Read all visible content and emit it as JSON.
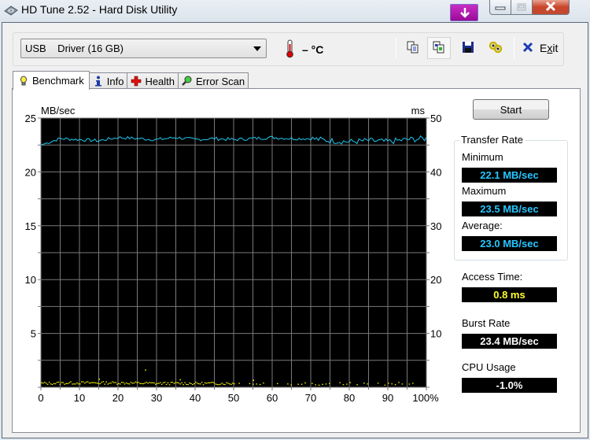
{
  "window": {
    "title": "HD Tune 2.52 - Hard Disk Utility",
    "icons": {
      "app": "hard-disk-icon",
      "download_badge": "download-arrow-icon",
      "minimize": "minimize-icon",
      "maximize": "maximize-icon",
      "close": "close-icon"
    }
  },
  "toolbar": {
    "drive_select": {
      "bus": "USB",
      "name": "Driver (16 GB)",
      "value": "USB    Driver (16 GB)"
    },
    "temperature": "– °C",
    "buttons": [
      {
        "name": "copy-text",
        "icon": "copy-text-icon"
      },
      {
        "name": "copy-screenshot",
        "icon": "copy-screenshot-icon",
        "active": true
      },
      {
        "name": "save",
        "icon": "floppy-disk-icon"
      },
      {
        "name": "options",
        "icon": "options-icon"
      }
    ],
    "exit_label": "Exit",
    "exit_mnemonic_prefix": "E",
    "exit_mnemonic_char": "x",
    "exit_mnemonic_suffix": "it"
  },
  "tabs": [
    {
      "label": "Benchmark",
      "icon": "lightbulb-icon",
      "active": true
    },
    {
      "label": "Info",
      "icon": "info-icon",
      "active": false
    },
    {
      "label": "Health",
      "icon": "health-cross-icon",
      "active": false
    },
    {
      "label": "Error Scan",
      "icon": "magnifier-icon",
      "active": false
    }
  ],
  "benchmark": {
    "start_label": "Start",
    "transfer_rate_title": "Transfer Rate",
    "minimum_label": "Minimum",
    "minimum_value": "22.1 MB/sec",
    "maximum_label": "Maximum",
    "maximum_value": "23.5 MB/sec",
    "average_label": "Average:",
    "average_value": "23.0 MB/sec",
    "access_time_label": "Access Time:",
    "access_time_value": "0.8 ms",
    "burst_rate_label": "Burst Rate",
    "burst_rate_value": "23.4 MB/sec",
    "cpu_usage_label": "CPU Usage",
    "cpu_usage_value": "-1.0%"
  },
  "chart_data": {
    "type": "line",
    "title": "",
    "ylabel": "MB/sec",
    "y2label": "ms",
    "xlabel": "",
    "xlim": [
      0,
      100
    ],
    "ylim": [
      0,
      25
    ],
    "y2lim": [
      0,
      50
    ],
    "x_ticks": [
      "0",
      "10",
      "20",
      "30",
      "40",
      "50",
      "60",
      "70",
      "80",
      "90",
      "100%"
    ],
    "y_ticks": [
      "5",
      "10",
      "15",
      "20",
      "25"
    ],
    "y2_ticks": [
      "10",
      "20",
      "30",
      "40",
      "50"
    ],
    "grid": true,
    "background": "#000000",
    "series": [
      {
        "name": "Transfer Rate (MB/sec)",
        "axis": "left",
        "color": "#1ec8f0",
        "min": 22.1,
        "max": 23.5,
        "average": 23.0,
        "x": [
          0,
          5,
          10,
          15,
          20,
          25,
          30,
          35,
          40,
          45,
          50,
          55,
          60,
          65,
          70,
          75,
          80,
          85,
          90,
          95,
          100
        ],
        "values": [
          22.5,
          23.1,
          23.0,
          22.9,
          23.2,
          23.1,
          23.0,
          23.2,
          23.0,
          23.1,
          23.0,
          23.1,
          23.2,
          23.1,
          23.1,
          22.9,
          22.8,
          22.9,
          22.8,
          23.0,
          23.1
        ]
      },
      {
        "name": "Access Time (ms)",
        "axis": "right",
        "color": "#ffff00",
        "average": 0.8,
        "x": [
          0,
          10,
          20,
          30,
          40,
          50,
          60,
          70,
          80,
          90,
          97
        ],
        "values": [
          0.8,
          0.9,
          0.9,
          0.8,
          0.8,
          0.8,
          0.8,
          0.7,
          0.8,
          0.7,
          0.8
        ]
      }
    ]
  }
}
